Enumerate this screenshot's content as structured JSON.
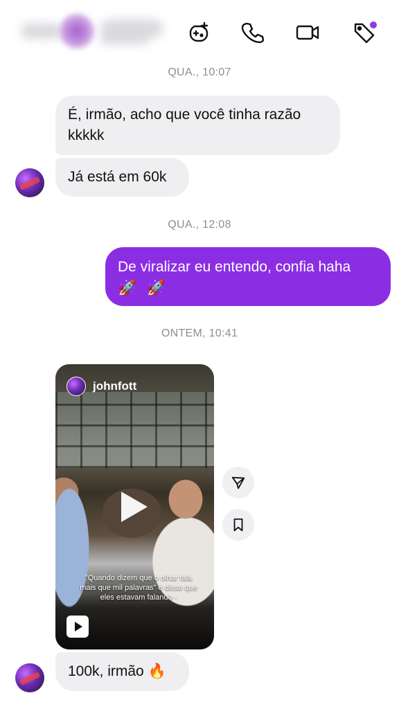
{
  "header": {
    "icons": [
      "add-game-icon",
      "phone-icon",
      "video-camera-icon",
      "tag-icon"
    ],
    "accent": "#8b2ee3"
  },
  "messages": {
    "ts1": "QUA., 10:07",
    "m1": "É, irmão, acho que você tinha razão kkkkk",
    "m2": "Já está em 60k",
    "ts2": "QUA., 12:08",
    "sent": "De viralizar eu entendo, confia haha",
    "sent_emoji": "🚀 🚀",
    "ts3": "ONTEM, 10:41",
    "reel": {
      "username": "johnfott",
      "caption": "\"Quando dizem que o olhar fala mais que mil palavras\" é disso que eles estavam falando -"
    },
    "m3": "100k, irmão 🔥"
  },
  "colors": {
    "sent_bubble": "#8b2ee3",
    "received_bubble": "#efeff1",
    "timestamp": "#8e8e93"
  }
}
